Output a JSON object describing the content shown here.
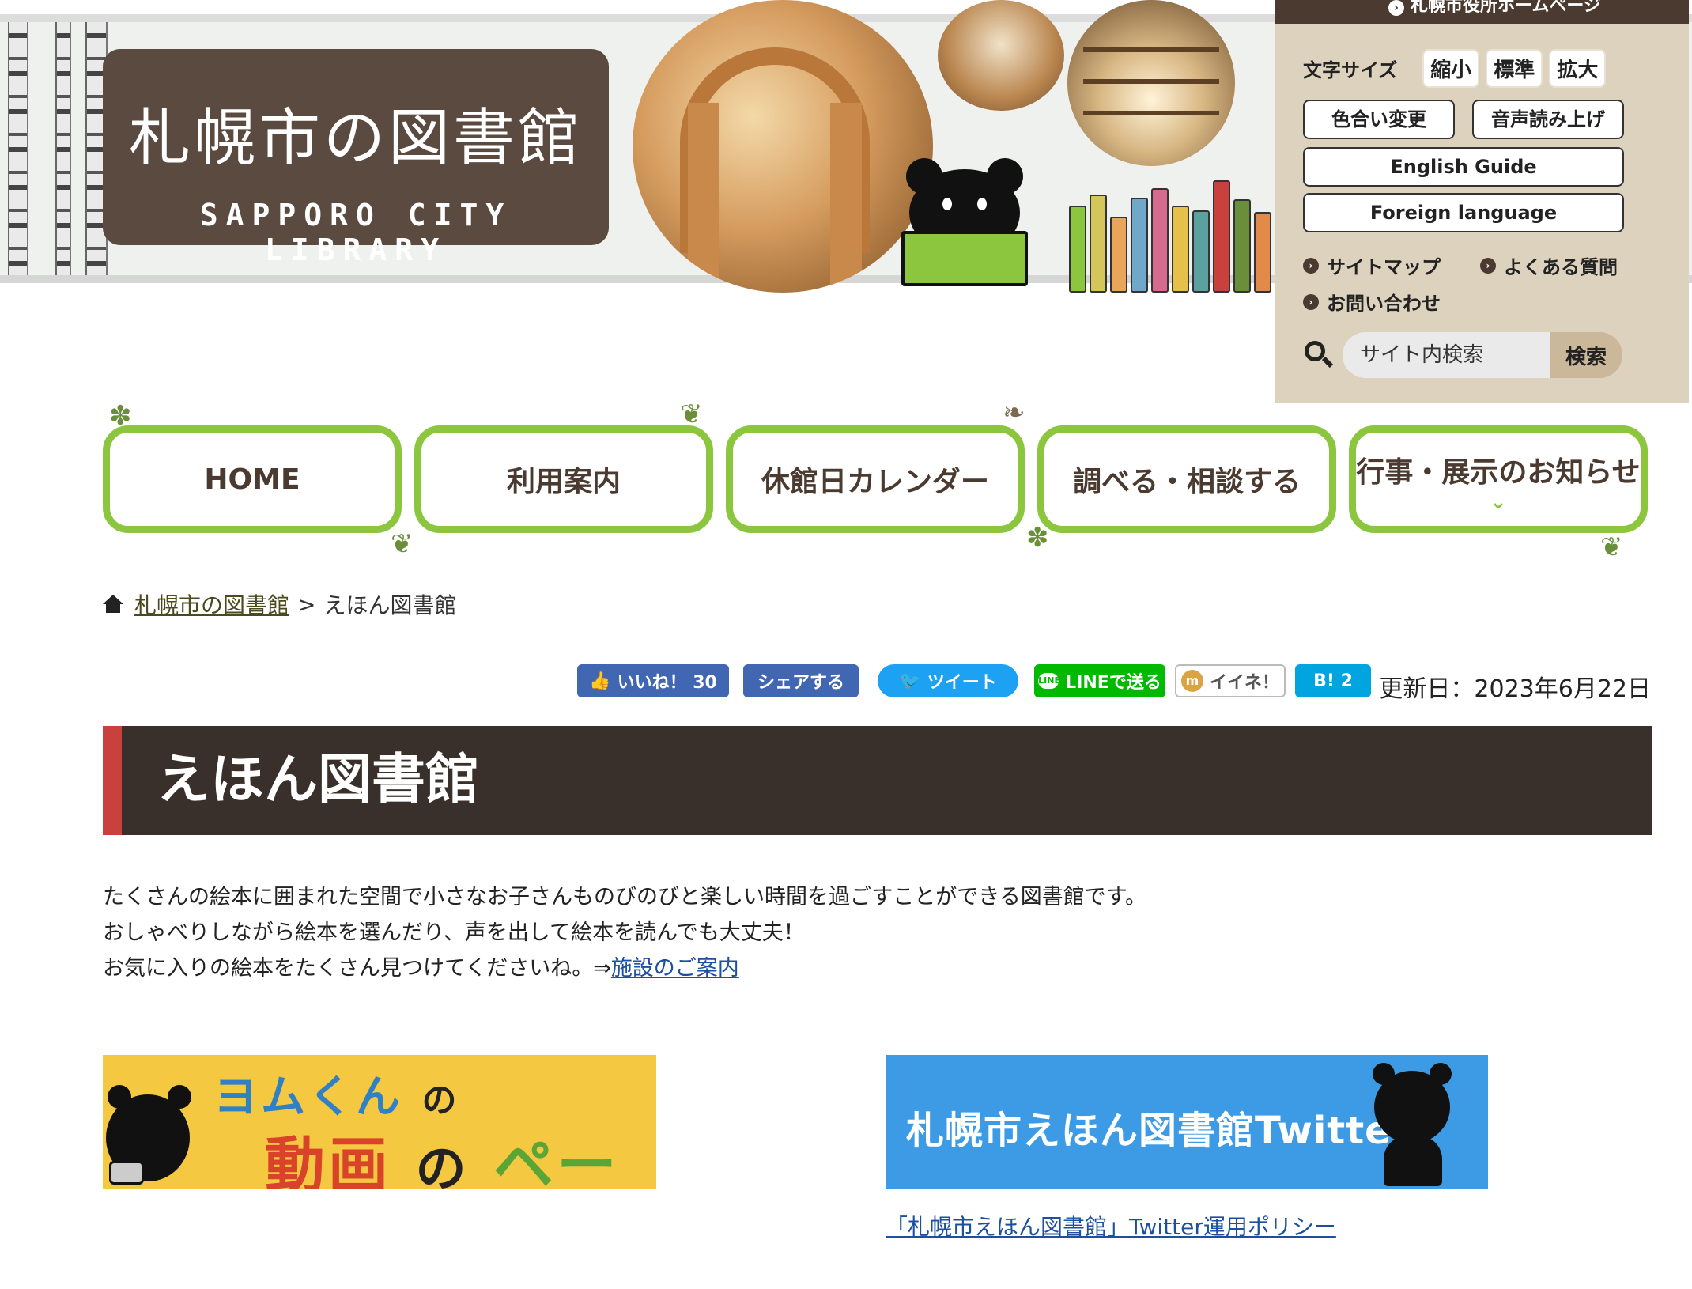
{
  "header": {
    "logo_jp": "札幌市の図書館",
    "logo_en": "SAPPORO CITY LIBRARY"
  },
  "utility": {
    "city_home_link": "札幌市役所ホームページ",
    "font_size_label": "文字サイズ",
    "font_small": "縮小",
    "font_standard": "標準",
    "font_large": "拡大",
    "color_change": "色合い変更",
    "voice_read": "音声読み上げ",
    "english_guide": "English Guide",
    "foreign_language": "Foreign language",
    "sitemap": "サイトマップ",
    "faq": "よくある質問",
    "contact": "お問い合わせ",
    "search_placeholder": "サイト内検索",
    "search_button": "検索"
  },
  "nav": {
    "items": [
      {
        "label": "HOME"
      },
      {
        "label": "利用案内"
      },
      {
        "label": "休館日カレンダー"
      },
      {
        "label": "調べる・相談する"
      },
      {
        "label": "行事・展示のお知らせ"
      }
    ]
  },
  "breadcrumb": {
    "home": "札幌市の図書館",
    "separator": ">",
    "current": "えほん図書館"
  },
  "social": {
    "like": "いいね！ 30",
    "share": "シェアする",
    "tweet": "ツイート",
    "line": "LINEで送る",
    "mixi": "イイネ！",
    "hatena": "B! 2",
    "updated": "更新日：2023年6月22日"
  },
  "page": {
    "title": "えほん図書館",
    "intro_line1": "たくさんの絵本に囲まれた空間で小さなお子さんものびのびと楽しい時間を過ごすことができる図書館です。",
    "intro_line2": "おしゃべりしながら絵本を選んだり、声を出して絵本を読んでも大丈夫！",
    "intro_line3": "お気に入りの絵本をたくさん見つけてくださいね。⇒",
    "facility_link": "施設のご案内"
  },
  "banners": {
    "video_line1_a": "ヨムくん",
    "video_line1_b": "の",
    "video_line2_a": "動画",
    "video_line2_b": "の",
    "video_line2_c": "ページ",
    "twitter_text": "札幌市えほん図書館Twitter",
    "twitter_policy": "「札幌市えほん図書館」Twitter運用ポリシー"
  },
  "colors": {
    "accent_green": "#8cc63f",
    "title_bar": "#3a302b",
    "title_accent": "#c9413d",
    "utility_bg": "#ddd2bd",
    "facebook": "#4267b2",
    "twitter": "#1da1f2",
    "line": "#00b900",
    "hatena": "#00a4de"
  }
}
